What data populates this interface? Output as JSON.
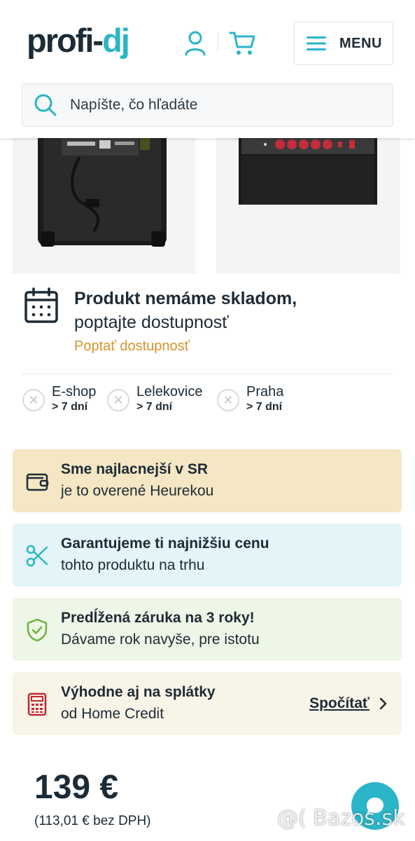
{
  "header": {
    "logo_main": "profi-",
    "logo_accent": "dj",
    "menu_label": "MENU",
    "search_placeholder": "Napíšte, čo hľadáte"
  },
  "availability": {
    "title": "Produkt nemáme skladom,",
    "subtitle": "poptajte dostupnosť",
    "link": "Poptať dostupnosť"
  },
  "stores": [
    {
      "name": "E-shop",
      "days": "> 7 dní"
    },
    {
      "name": "Lelekovice",
      "days": "> 7 dní"
    },
    {
      "name": "Praha",
      "days": "> 7 dní"
    }
  ],
  "benefits": [
    {
      "title": "Sme najlacnejší v SR",
      "subtitle": "je to overené Heurekou",
      "bg": "#f5e7c4",
      "icon": "wallet-icon"
    },
    {
      "title": "Garantujeme ti najnižšiu cenu",
      "subtitle": "tohto produktu na trhu",
      "bg": "#e3f5f8",
      "icon": "scissors-icon"
    },
    {
      "title": "Predĺžená záruka na 3 roky!",
      "subtitle": "Dávame rok navyše, pre istotu",
      "bg": "#eef6e7",
      "icon": "shield-check-icon"
    },
    {
      "title": "Výhodne aj na splátky",
      "subtitle": "od Home Credit",
      "link": "Spočítať",
      "bg": "#f9f4e8",
      "icon": "calculator-icon"
    }
  ],
  "price": {
    "value": "139 €",
    "net": "(113,01 € bez DPH)"
  },
  "watermark": "@( Bazos.sk",
  "colors": {
    "accent": "#2bb5c8",
    "dark": "#1d2b36",
    "orange_link": "#d9922a"
  }
}
